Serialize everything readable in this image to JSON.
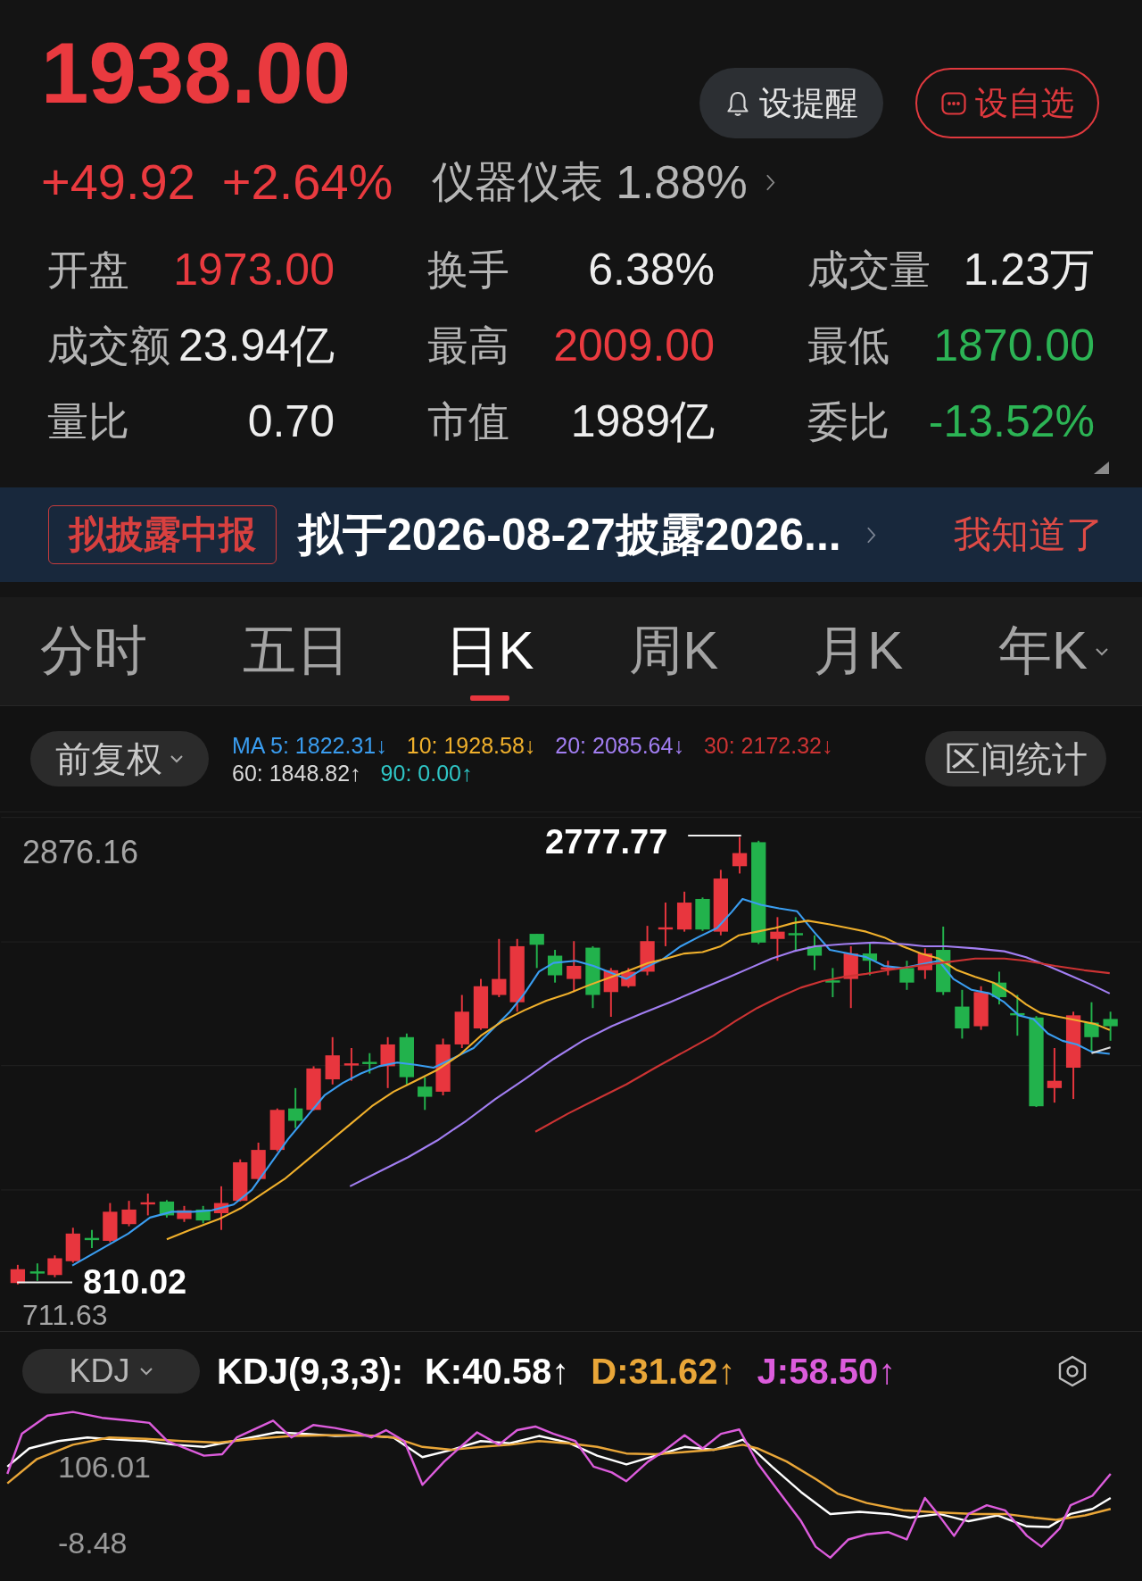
{
  "quote": {
    "price": "1938.00",
    "change": "+49.92",
    "change_pct": "+2.64%",
    "rising": true
  },
  "sector": {
    "name": "仪器仪表",
    "change_pct": "1.88%"
  },
  "actions": [
    {
      "label": "设提醒",
      "kind": "alert"
    },
    {
      "label": "设自选",
      "kind": "watchlist"
    }
  ],
  "stats": [
    {
      "label": "开盘",
      "value": "1973.00",
      "color": "#ea3a3f"
    },
    {
      "label": "换手",
      "value": "6.38%",
      "color": "#ededed"
    },
    {
      "label": "成交量",
      "value": "1.23万",
      "color": "#ededed"
    },
    {
      "label": "成交额",
      "value": "23.94亿",
      "color": "#ededed"
    },
    {
      "label": "最高",
      "value": "2009.00",
      "color": "#ea3a3f"
    },
    {
      "label": "最低",
      "value": "1870.00",
      "color": "#2cb455"
    },
    {
      "label": "量比",
      "value": "0.70",
      "color": "#ededed"
    },
    {
      "label": "市值",
      "value": "1989亿",
      "color": "#ededed"
    },
    {
      "label": "委比",
      "value": "-13.52%",
      "color": "#2cb455"
    }
  ],
  "notice": {
    "tag": "拟披露中报",
    "text": "拟于2026-08-27披露2026...",
    "dismiss": "我知道了"
  },
  "period_tabs": [
    {
      "label": "分时",
      "selected": false,
      "dropdown": false
    },
    {
      "label": "五日",
      "selected": false,
      "dropdown": false
    },
    {
      "label": "日K",
      "selected": true,
      "dropdown": false
    },
    {
      "label": "周K",
      "selected": false,
      "dropdown": false
    },
    {
      "label": "月K",
      "selected": false,
      "dropdown": false
    },
    {
      "label": "年K",
      "selected": false,
      "dropdown": true
    }
  ],
  "chart_toolbar": {
    "adjust": "前复权",
    "ma_legend": [
      {
        "label": "MA 5: 1822.31↓",
        "color": "#3a9df0"
      },
      {
        "label": "10: 1928.58↓",
        "color": "#f0b02c"
      },
      {
        "label": "20: 2085.64↓",
        "color": "#a27ef2"
      },
      {
        "label": "30: 2172.32↓",
        "color": "#cc3333"
      },
      {
        "label": "60: 1848.82↑",
        "color": "#d9d9d9"
      },
      {
        "label": "90: 0.00↑",
        "color": "#2fc6c6"
      }
    ],
    "range_button": "区间统计"
  },
  "price_chart": {
    "y_max_label": "2876.16",
    "y_min_label": "711.63",
    "high_label": "2777.77",
    "low_label": "810.02"
  },
  "indicator": {
    "selector": "KDJ",
    "params": "KDJ(9,3,3):",
    "values": [
      {
        "label": "K:40.58↑",
        "color": "#ffffff"
      },
      {
        "label": "D:31.62↑",
        "color": "#e9a638"
      },
      {
        "label": "J:58.50↑",
        "color": "#dc5cdc"
      }
    ],
    "y_max_label": "106.01",
    "y_min_label": "-8.48"
  }
}
